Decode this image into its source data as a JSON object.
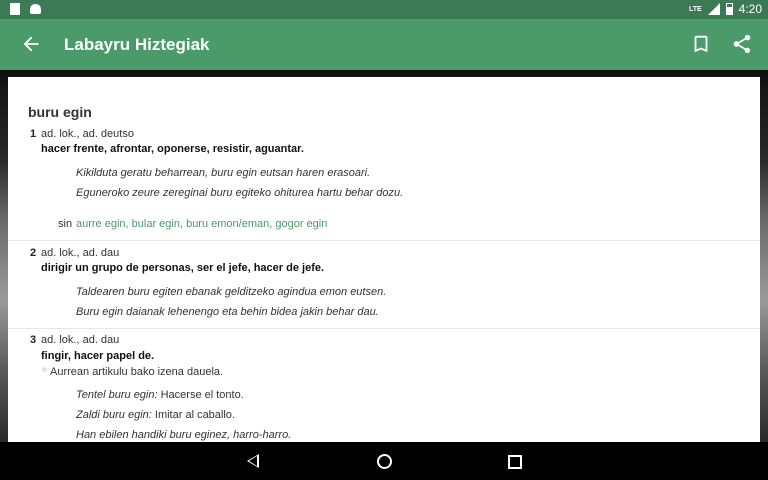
{
  "status_bar": {
    "network": "LTE",
    "time": "4:20",
    "icons": [
      "sd-card-icon",
      "android-icon",
      "signal-icon",
      "battery-icon"
    ]
  },
  "app_bar": {
    "title": "Labayru Hiztegiak",
    "icons": [
      "back-arrow-icon",
      "bookmark-icon",
      "share-icon"
    ],
    "color": "#4a9a6a"
  },
  "entry": {
    "headword": "buru egin",
    "senses": [
      {
        "num": "1",
        "gram": "ad. lok., ad. deutso",
        "definition": "hacer frente, afrontar, oponerse, resistir, aguantar.",
        "examples": [
          "Kikilduta geratu beharrean, buru egin eutsan haren erasoari.",
          "Eguneroko zeure zereginai buru egiteko ohiturea hartu behar dozu."
        ],
        "sin_label": "sin",
        "synonyms": "aurre egin, bular egin, buru emon/eman, gogor egin"
      },
      {
        "num": "2",
        "gram": "ad. lok., ad. dau",
        "definition": "dirigir un grupo de personas, ser el jefe, hacer de jefe.",
        "examples": [
          "Taldearen buru egiten ebanak gelditzeko agindua emon eutsen.",
          "Buru egin daianak lehenengo eta behin bidea jakin behar dau."
        ]
      },
      {
        "num": "3",
        "gram": "ad. lok., ad. dau",
        "definition": "fingir, hacer papel de.",
        "note": "Aurrean artikulu bako izena dauela.",
        "examples": [
          {
            "phrase": "Tentel buru egin:",
            "translation": "Hacerse el tonto."
          },
          {
            "phrase": "Zaldi buru egin:",
            "translation": "Imitar al caballo."
          },
          {
            "phrase": "Han ebilen handiki buru eginez, harro-harro.",
            "translation": ""
          }
        ]
      }
    ]
  },
  "nav_bar": {
    "icons": [
      "nav-back-icon",
      "nav-home-icon",
      "nav-recents-icon"
    ]
  }
}
